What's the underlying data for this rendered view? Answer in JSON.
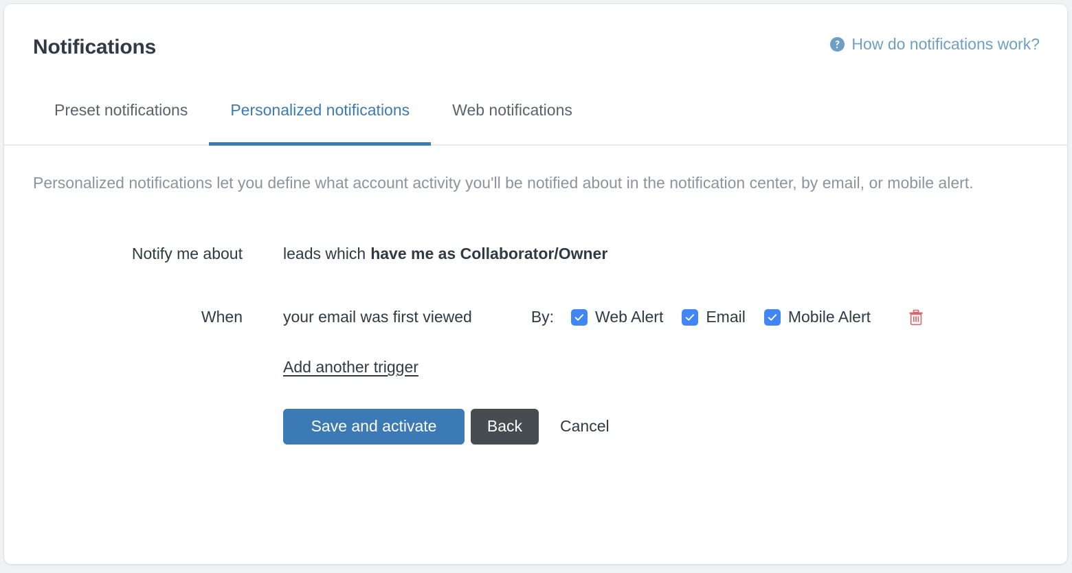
{
  "header": {
    "title": "Notifications",
    "help_link": "How do notifications work?",
    "help_icon": "question-circle-icon"
  },
  "tabs": [
    {
      "label": "Preset notifications",
      "active": false
    },
    {
      "label": "Personalized notifications",
      "active": true
    },
    {
      "label": "Web notifications",
      "active": false
    }
  ],
  "intro": "Personalized notifications let you define what account activity you'll be notified about in the notification center, by email, or mobile alert.",
  "form": {
    "notify_label": "Notify me about",
    "notify_prefix": "leads which",
    "notify_condition": "have me as Collaborator/Owner",
    "when_label": "When",
    "when_trigger": "your email was first viewed",
    "by_label": "By:",
    "channels": [
      {
        "label": "Web Alert",
        "checked": true
      },
      {
        "label": "Email",
        "checked": true
      },
      {
        "label": "Mobile Alert",
        "checked": true
      }
    ],
    "delete_icon": "trash-icon",
    "add_trigger": "Add another trigger"
  },
  "actions": {
    "save": "Save and activate",
    "back": "Back",
    "cancel": "Cancel"
  },
  "colors": {
    "accent_blue": "#3b7ab5",
    "link_blue": "#6d9fc6",
    "checkbox_blue": "#4285f4",
    "dark_button": "#474c51",
    "delete_red": "#d9646a",
    "text_dark": "#2f3a44",
    "text_muted": "#8b949c"
  }
}
